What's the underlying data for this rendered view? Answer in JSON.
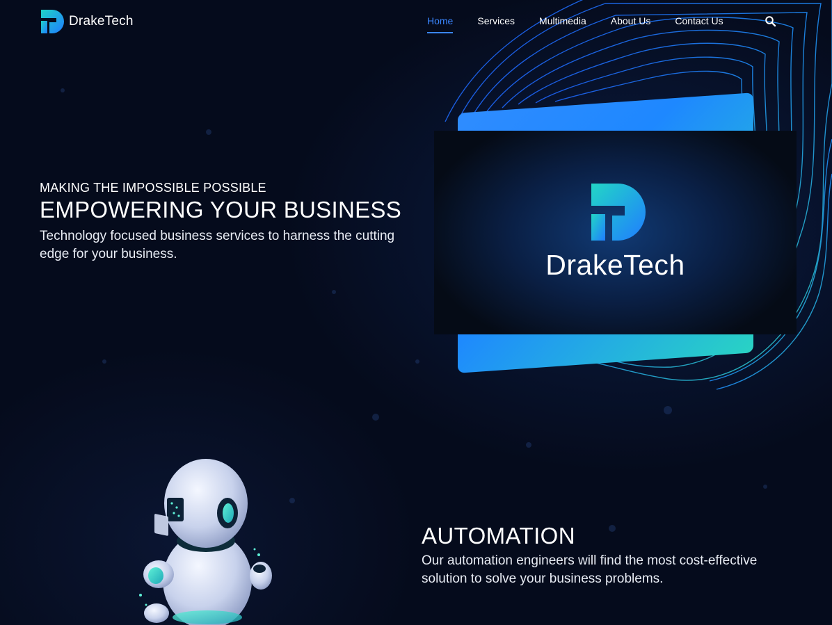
{
  "brand": {
    "name": "DrakeTech",
    "logo_icon": "draketech-logo-icon"
  },
  "nav": {
    "items": [
      {
        "label": "Home",
        "active": true
      },
      {
        "label": "Services",
        "active": false
      },
      {
        "label": "Multimedia",
        "active": false
      },
      {
        "label": "About Us",
        "active": false
      },
      {
        "label": "Contact Us",
        "active": false
      }
    ],
    "search_icon": "search-icon"
  },
  "hero": {
    "eyebrow": "MAKING THE IMPOSSIBLE POSSIBLE",
    "title": "EMPOWERING YOUR BUSINESS",
    "description": "Technology focused business services to harness the cutting edge for your business.",
    "video_logo_text": "DrakeTech"
  },
  "automation": {
    "title": "AUTOMATION",
    "description": "Our automation engineers will find the most cost-effective solution to solve your business problems.",
    "image_icon": "robot-illustration"
  },
  "colors": {
    "background": "#050b1c",
    "accent_blue": "#3a86ff",
    "accent_teal": "#2ed3c0",
    "text": "#ffffff"
  }
}
